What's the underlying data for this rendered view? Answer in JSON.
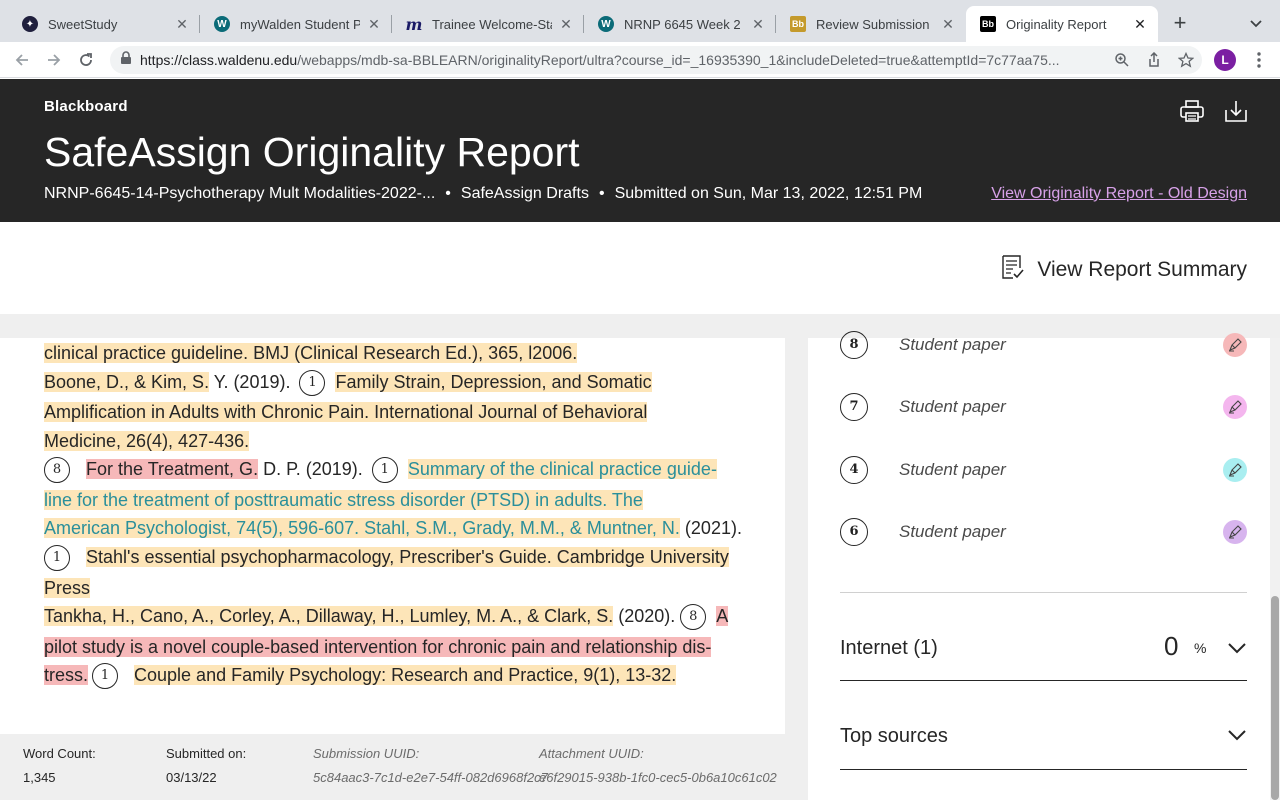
{
  "browser": {
    "tabs": [
      {
        "title": "SweetStudy",
        "favicon": "sweetstudy-icon",
        "color": "#1f1f3d"
      },
      {
        "title": "myWalden Student Por",
        "favicon": "walden-icon",
        "color": "#0b6b78"
      },
      {
        "title": "Trainee Welcome-Star",
        "favicon": "m-logo-icon",
        "color": "#1a1a66"
      },
      {
        "title": "NRNP 6645 Week 2",
        "favicon": "walden-icon",
        "color": "#0b6b78"
      },
      {
        "title": "Review Submission His",
        "favicon": "blackboard-icon",
        "color": "#c49a2c"
      },
      {
        "title": "Originality Report",
        "favicon": "blackboard-icon",
        "color": "#000000"
      }
    ],
    "url_host": "https://class.waldenu.edu",
    "url_path": "/webapps/mdb-sa-BBLEARN/originalityReport/ultra?course_id=_16935390_1&includeDeleted=true&attemptId=7c77aa75...",
    "profile_initial": "L"
  },
  "header": {
    "brand": "Blackboard",
    "title": "SafeAssign Originality Report",
    "course": "NRNP-6645-14-Psychotherapy Mult Modalities-2022-...",
    "drafts": "SafeAssign Drafts",
    "submitted": "Submitted on Sun, Mar 13, 2022, 12:51 PM",
    "old_design_link": "View Originality Report - Old Design"
  },
  "summary": {
    "button_label": "View Report Summary"
  },
  "paper": {
    "l1": "clinical practice guideline. BMJ (Clinical Research Ed.), 365, l2006.",
    "l2a": "Boone, D., & Kim, S.",
    "l2b": " Y. (2019). ",
    "l2badge": "1",
    "l2c": "Family Strain, Depression, and Somatic",
    "l3": "Amplification in Adults with Chronic Pain. International Journal of Behavioral",
    "l4": "Medicine, 26(4), 427-436.",
    "l5badge1": "8",
    "l5a": "For the Treatment, G.",
    "l5b": " D. P. (2019). ",
    "l5badge2": "1",
    "l5c": "Summary of the clinical practice guide-",
    "l6": "line for the treatment of posttraumatic stress disorder (PTSD) in adults. The",
    "l7a": "American Psychologist, 74(5), 596-607. Stahl, S.M., Grady, M.M., & Muntner, N.",
    "l7b": " (2021).",
    "l8badge": "1",
    "l8a": "Stahl's essential psychopharmacology, Prescriber's Guide. Cambridge University",
    "l9": "Press",
    "l10a": "Tankha, H., Cano, A., Corley, A., Dillaway, H., Lumley, M. A., & Clark, S.",
    "l10b": " (2020). ",
    "l10badge": "8",
    "l10c": "A",
    "l11": "pilot study is a novel couple-based intervention for chronic pain and relationship dis-",
    "l12a": "tress.",
    "l12badge": "1",
    "l12b": "Couple and Family Psychology: Research and Practice, 9(1), 13-32."
  },
  "footer": {
    "word_count_label": "Word Count:",
    "word_count": "1,345",
    "submitted_label": "Submitted on:",
    "submitted": "03/13/22",
    "submission_uuid_label": "Submission UUID:",
    "submission_uuid": "5c84aac3-7c1d-e2e7-54ff-082d6968f2c7",
    "attachment_uuid_label": "Attachment UUID:",
    "attachment_uuid": "e6f29015-938b-1fc0-cec5-0b6a10c61c02"
  },
  "sources": {
    "items": [
      {
        "number": "8",
        "label": "Student paper",
        "color": "#f6b8b9"
      },
      {
        "number": "7",
        "label": "Student paper",
        "color": "#f4b6ee"
      },
      {
        "number": "4",
        "label": "Student paper",
        "color": "#a9eef0"
      },
      {
        "number": "6",
        "label": "Student paper",
        "color": "#d7b4ee"
      }
    ],
    "internet_title": "Internet (1)",
    "internet_pct": "0",
    "pct_symbol": "%",
    "top_sources_title": "Top sources"
  }
}
